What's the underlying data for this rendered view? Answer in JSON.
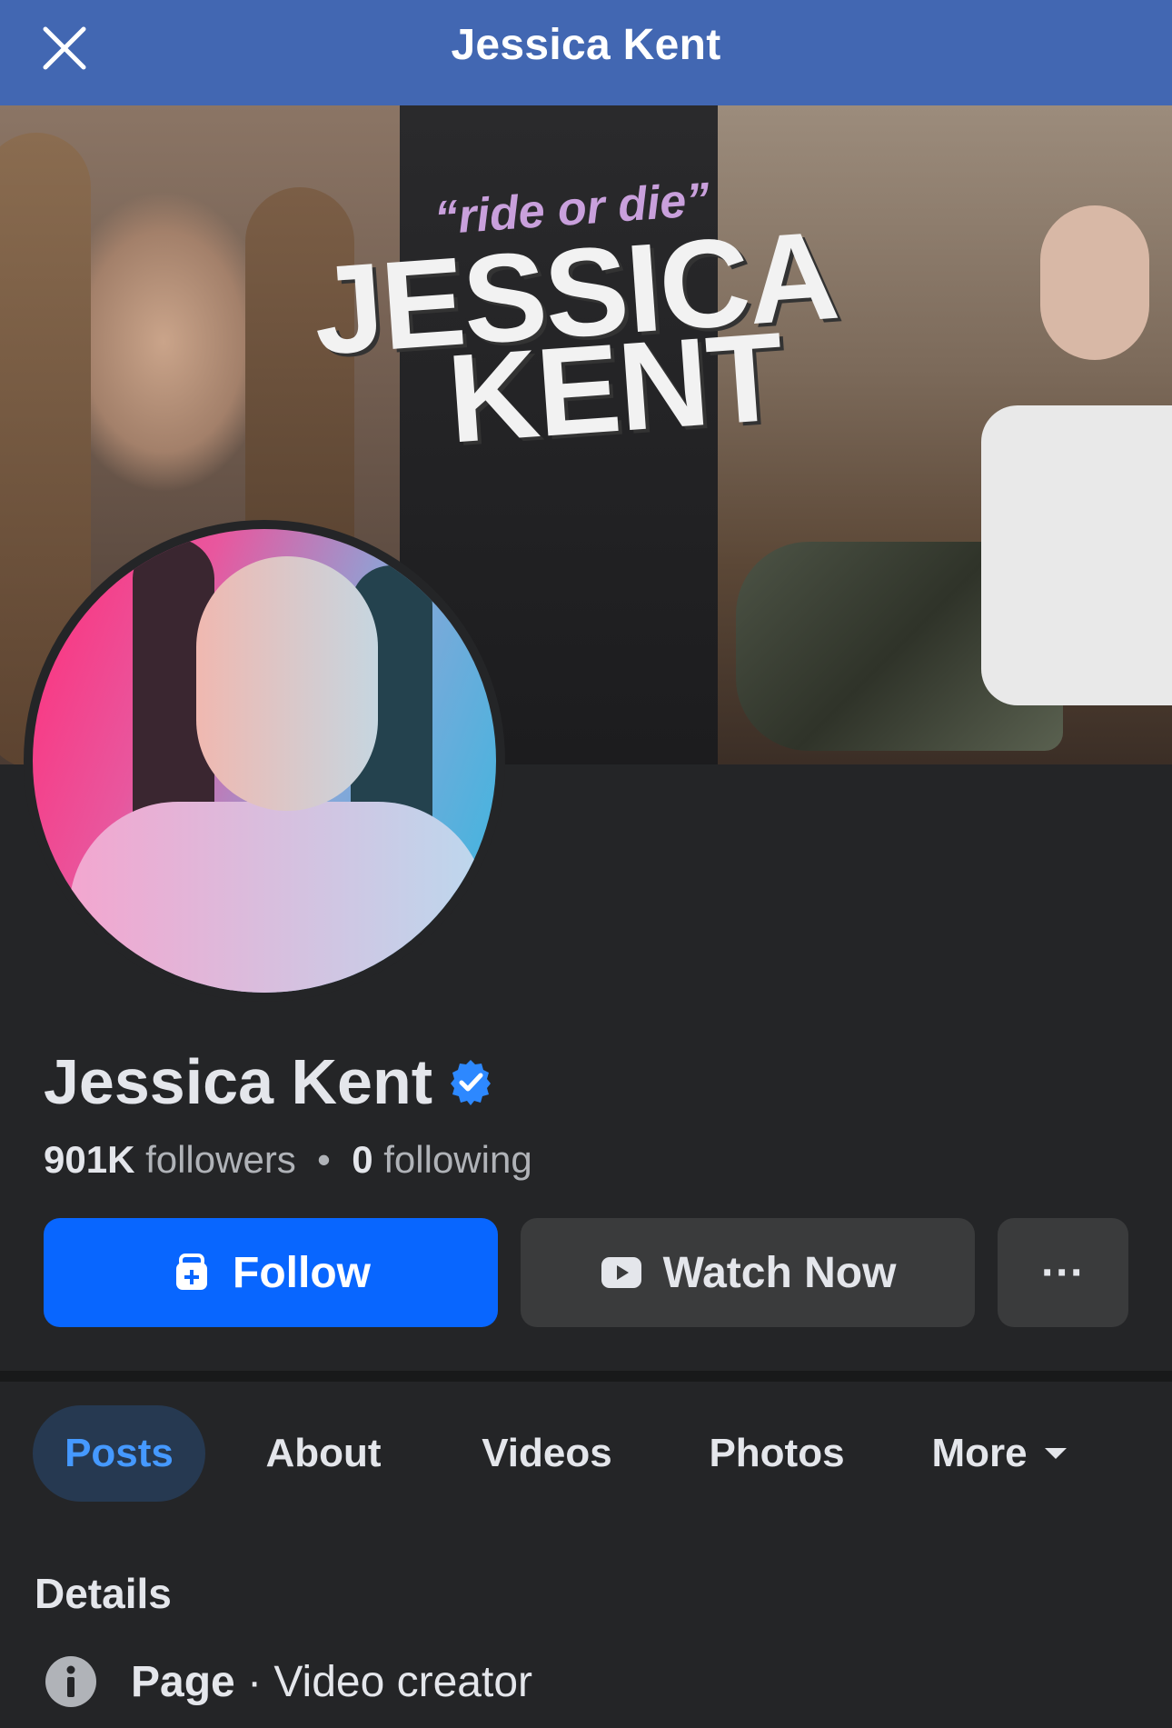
{
  "header": {
    "title": "Jessica Kent",
    "close_icon": "close-icon"
  },
  "cover": {
    "tagline": "“ride or die”",
    "brand_line1": "JESSICA",
    "brand_line2": "KENT"
  },
  "profile": {
    "name": "Jessica Kent",
    "verified_icon": "verified-badge-icon",
    "followers_count": "901K",
    "followers_label": "followers",
    "separator": "•",
    "following_count": "0",
    "following_label": "following"
  },
  "actions": {
    "follow_label": "Follow",
    "watch_label": "Watch Now",
    "more_label": "···"
  },
  "tabs": [
    {
      "label": "Posts",
      "active": true
    },
    {
      "label": "About",
      "active": false
    },
    {
      "label": "Videos",
      "active": false
    },
    {
      "label": "Photos",
      "active": false
    },
    {
      "label": "More",
      "active": false
    }
  ],
  "details": {
    "title": "Details",
    "row_type": "Page",
    "row_dot": " · ",
    "row_category": "Video creator"
  },
  "colors": {
    "header_bg": "#4267b2",
    "page_bg": "#242527",
    "primary_button": "#0866ff",
    "secondary_button": "#3a3b3c",
    "active_tab_bg": "#263951",
    "active_tab_text": "#4599ff",
    "verified_badge": "#2d88ff"
  }
}
